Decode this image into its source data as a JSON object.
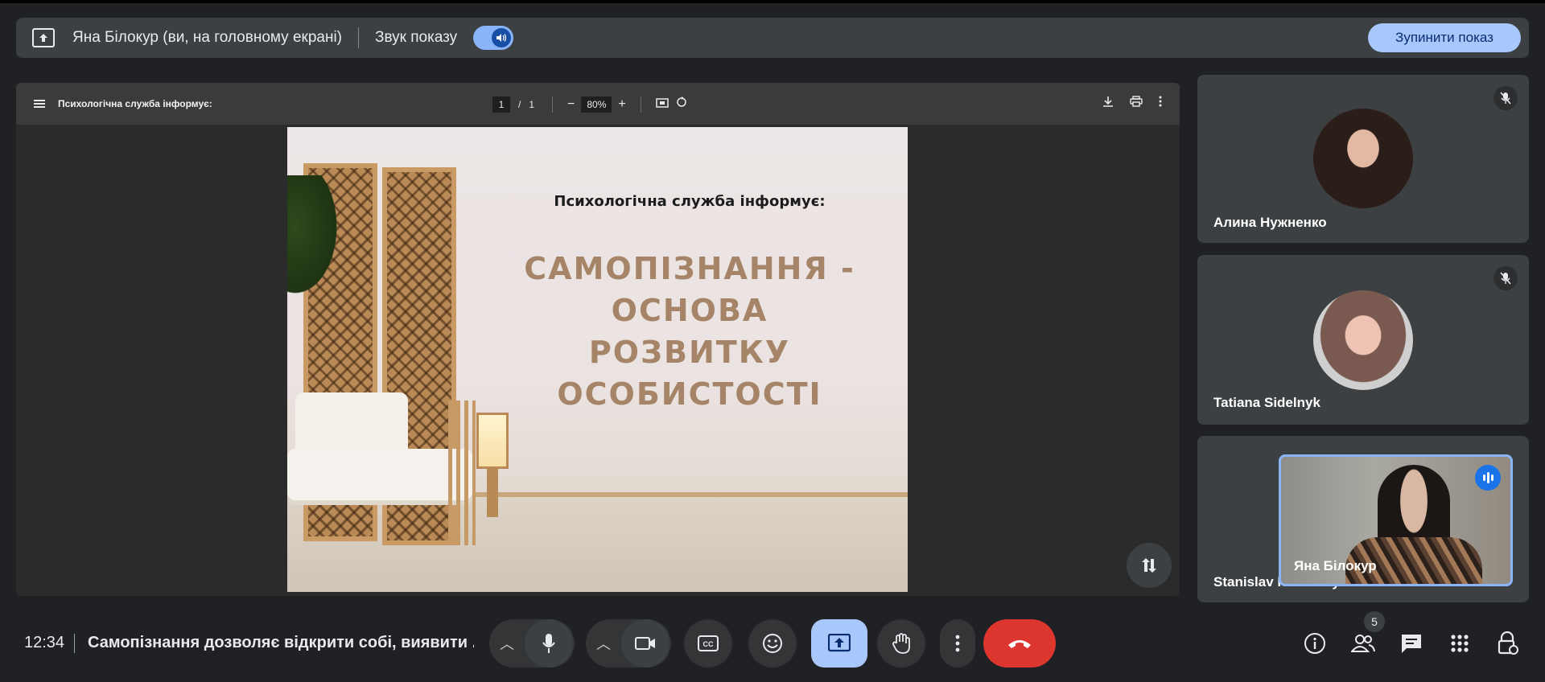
{
  "presenting_bar": {
    "presenter_text": "Яна Білокур (ви, на головному екрані)",
    "sound_label": "Звук показу",
    "sound_toggle_on": true,
    "stop_button": "Зупинити показ"
  },
  "pdf_viewer": {
    "title": "Психологічна служба інформує:",
    "current_page": "1",
    "page_separator": "/",
    "total_pages": "1",
    "zoom": "80%",
    "slide": {
      "subtitle": "Психологічна служба інформує:",
      "title_lines": [
        "САМОПІЗНАННЯ -",
        "ОСНОВА",
        "РОЗВИТКУ",
        "ОСОБИСТОСТІ"
      ]
    }
  },
  "participants": [
    {
      "name": "Алина Нужненко",
      "muted": true
    },
    {
      "name": "Tatiana Sidelnyk",
      "muted": true
    },
    {
      "name": "Stanislav Кочетову"
    }
  ],
  "self_view": {
    "name": "Яна Білокур",
    "speaking": true
  },
  "bottom_bar": {
    "time": "12:34",
    "meeting_name": "Самопізнання дозволяє відкрити собі, виявити ...",
    "people_count": "5"
  },
  "colors": {
    "background": "#202124",
    "accent": "#a8c7fa",
    "leave": "#dc362e",
    "slide_title": "#a58468"
  }
}
